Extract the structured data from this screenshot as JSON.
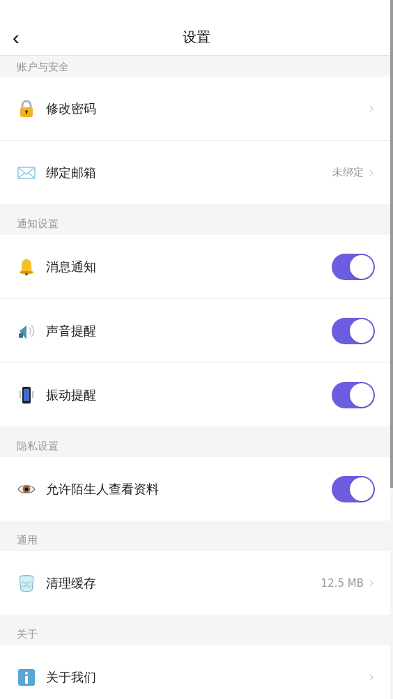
{
  "header": {
    "back": "‹",
    "title": "设置"
  },
  "sections": [
    {
      "title": "账户与安全",
      "rows": [
        {
          "kind": "link",
          "label": "修改密码"
        },
        {
          "kind": "link",
          "label": "绑定邮箱",
          "value": "未绑定"
        }
      ]
    },
    {
      "title": "通知设置",
      "rows": [
        {
          "kind": "toggle",
          "label": "消息通知",
          "on": true
        },
        {
          "kind": "toggle",
          "label": "声音提醒",
          "on": true
        },
        {
          "kind": "toggle",
          "label": "振动提醒",
          "on": true
        }
      ]
    },
    {
      "title": "隐私设置",
      "rows": [
        {
          "kind": "toggle",
          "label": "允许陌生人查看资料",
          "on": true
        }
      ]
    },
    {
      "title": "通用",
      "rows": [
        {
          "kind": "link",
          "label": "清理缓存",
          "value": "12.5 MB"
        }
      ]
    },
    {
      "title": "关于",
      "rows": [
        {
          "kind": "link",
          "label": "关于我们"
        }
      ]
    }
  ]
}
